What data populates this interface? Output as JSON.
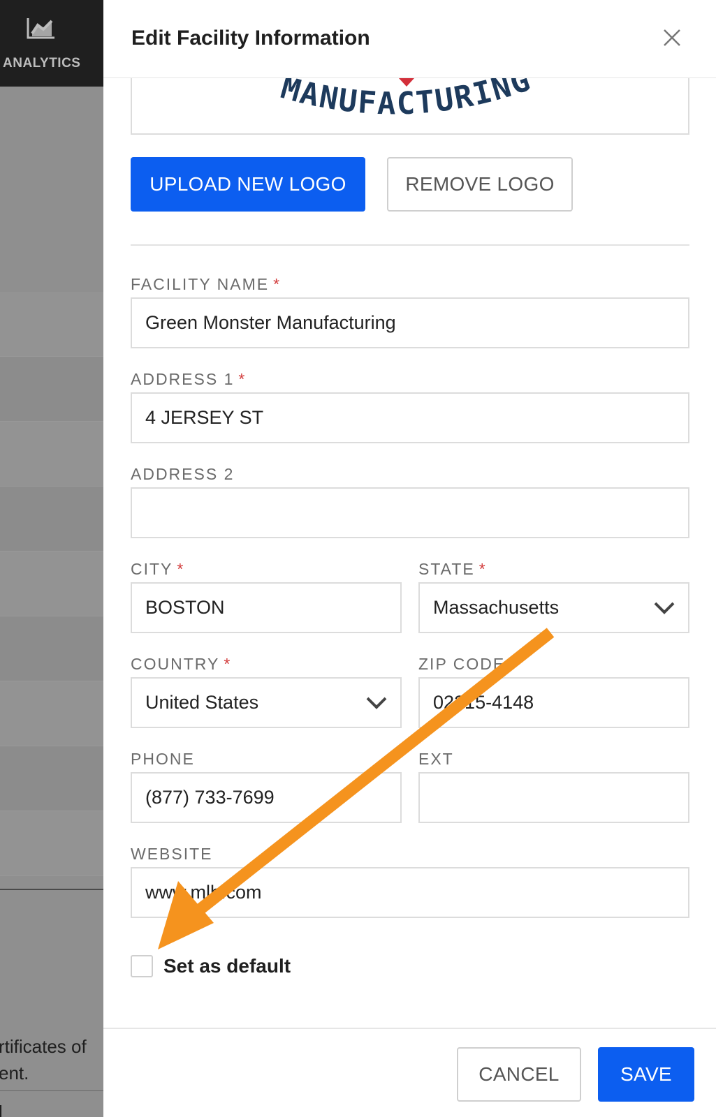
{
  "background_app": {
    "nav_label": "ANALYTICS",
    "snippet_line1": "rtificates of",
    "snippet_line2": "ent.",
    "snippet_line3": "l"
  },
  "modal": {
    "title": "Edit Facility Information",
    "logo_text": "MANUFACTURING",
    "upload_logo_label": "UPLOAD NEW LOGO",
    "remove_logo_label": "REMOVE LOGO",
    "required_marker": "*",
    "fields": {
      "facility_name": {
        "label": "FACILITY NAME",
        "required": true,
        "value": "Green Monster Manufacturing"
      },
      "address1": {
        "label": "ADDRESS 1",
        "required": true,
        "value": "4 JERSEY ST"
      },
      "address2": {
        "label": "ADDRESS 2",
        "required": false,
        "value": ""
      },
      "city": {
        "label": "CITY",
        "required": true,
        "value": "BOSTON"
      },
      "state": {
        "label": "STATE",
        "required": true,
        "value": "Massachusetts"
      },
      "country": {
        "label": "COUNTRY",
        "required": true,
        "value": "United States"
      },
      "zip": {
        "label": "ZIP CODE",
        "required": true,
        "value": "02215-4148"
      },
      "phone": {
        "label": "PHONE",
        "required": false,
        "value": "(877) 733-7699"
      },
      "ext": {
        "label": "EXT",
        "required": false,
        "value": ""
      },
      "website": {
        "label": "WEBSITE",
        "required": false,
        "value": "www.mlb.com"
      }
    },
    "set_default_label": "Set as default",
    "set_default_checked": false,
    "cancel_label": "CANCEL",
    "save_label": "SAVE"
  },
  "colors": {
    "primary": "#0c5ef0",
    "arrow": "#f5931e",
    "required": "#d23b3b",
    "logo_navy": "#1d3a5c",
    "logo_red": "#d32f3a"
  },
  "icons": {
    "nav": "analytics-chart-icon",
    "close": "close-icon",
    "dropdown": "chevron-down-icon"
  }
}
